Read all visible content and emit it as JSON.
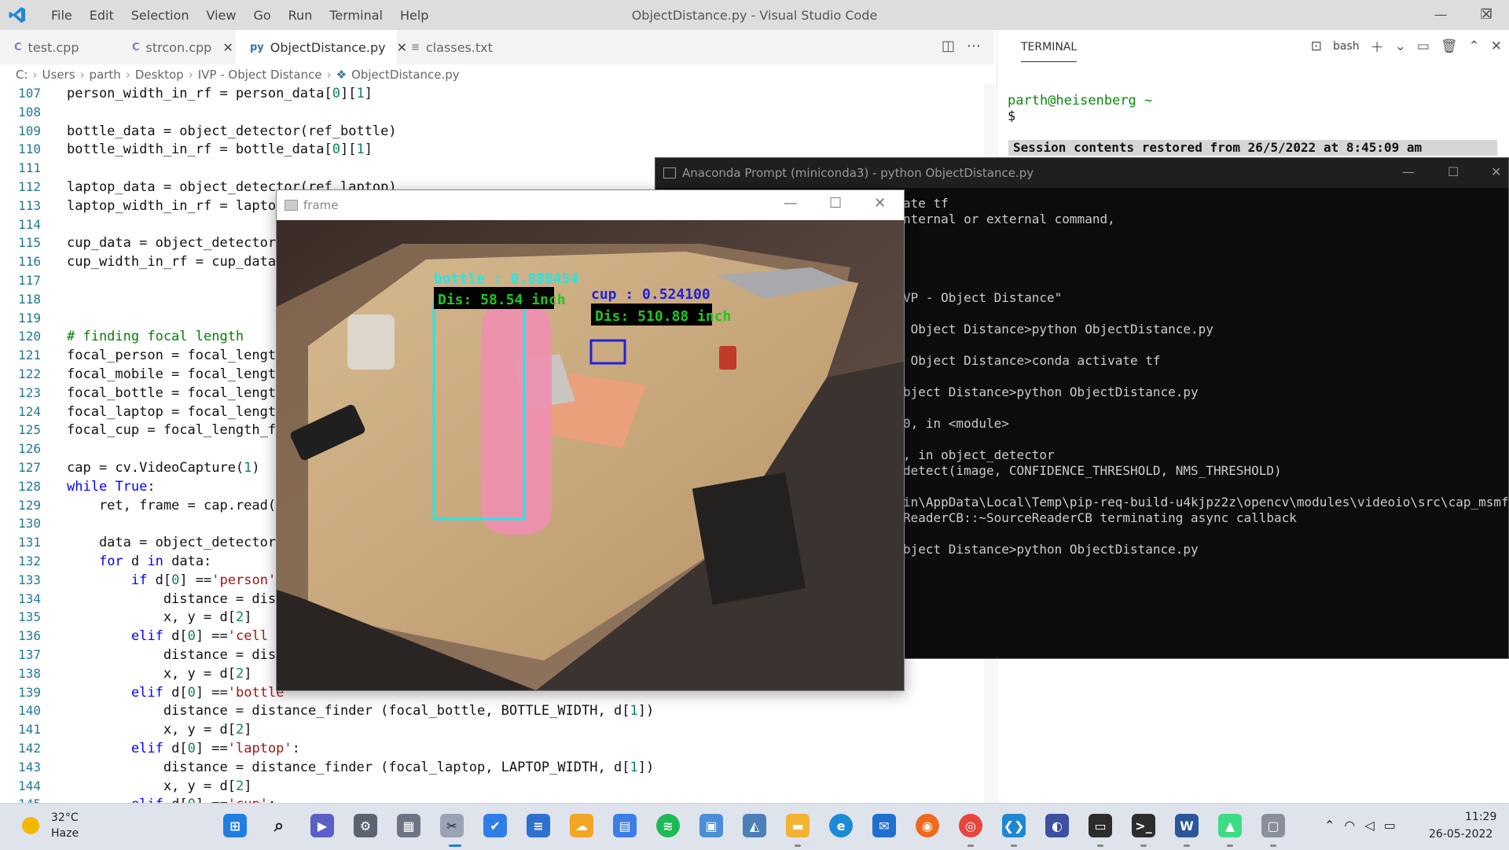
{
  "window": {
    "title": "ObjectDistance.py - Visual Studio Code"
  },
  "menu": [
    "File",
    "Edit",
    "Selection",
    "View",
    "Go",
    "Run",
    "Terminal",
    "Help"
  ],
  "tabs": [
    {
      "label": "test.cpp",
      "icon": "C"
    },
    {
      "label": "strcon.cpp",
      "icon": "C"
    },
    {
      "label": "ObjectDistance.py",
      "icon": "py"
    },
    {
      "label": "classes.txt",
      "icon": "≡"
    }
  ],
  "breadcrumb": [
    "C:",
    "Users",
    "parth",
    "Desktop",
    "IVP - Object Distance",
    "ObjectDistance.py"
  ],
  "code": {
    "line_numbers": [
      "107",
      "108",
      "109",
      "110",
      "111",
      "112",
      "113",
      "114",
      "115",
      "116",
      "117",
      "118",
      "119",
      "120",
      "121",
      "122",
      "123",
      "124",
      "125",
      "126",
      "127",
      "128",
      "129",
      "130",
      "131",
      "132",
      "133",
      "134",
      "135",
      "136",
      "137",
      "138",
      "139",
      "140",
      "141",
      "142",
      "143",
      "144",
      "145"
    ],
    "lines": [
      "person_width_in_rf = person_data[0][1]",
      "",
      "bottle_data = object_detector(ref_bottle)",
      "bottle_width_in_rf = bottle_data[0][1]",
      "",
      "laptop_data = object_detector(ref_laptop)",
      "laptop_width_in_rf = laptop_",
      "",
      "cup_data = object_detector(r",
      "cup_width_in_rf = cup_data[0",
      "",
      "",
      "",
      "# finding focal length",
      "focal_person = focal_length_",
      "focal_mobile = focal_length_",
      "focal_bottle = focal_length_",
      "focal_laptop = focal_length_",
      "focal_cup = focal_length_fir",
      "",
      "cap = cv.VideoCapture(1)",
      "while True:",
      "    ret, frame = cap.read()",
      "",
      "    data = object_detector(f",
      "    for d in data:",
      "        if d[0] =='person':",
      "            distance = dista",
      "            x, y = d[2]",
      "        elif d[0] =='cell ph",
      "            distance = dista",
      "            x, y = d[2]",
      "        elif d[0] =='bottle'",
      "            distance = distance_finder (focal_bottle, BOTTLE_WIDTH, d[1])",
      "            x, y = d[2]",
      "        elif d[0] =='laptop':",
      "            distance = distance_finder (focal_laptop, LAPTOP_WIDTH, d[1])",
      "            x, y = d[2]",
      "        elif d[0] =='cup':"
    ]
  },
  "terminal": {
    "tab_label": "TERMINAL",
    "shell_label": "bash",
    "prompt_user": "parth@heisenberg ~",
    "prompt_symbol": "$",
    "restored_message": "Session contents restored from 26/5/2022 at 8:45:09 am"
  },
  "anaconda": {
    "title": "Anaconda Prompt (miniconda3) - python  ObjectDistance.py",
    "lines": [
      {
        "text": "ate tf",
        "row": 0
      },
      {
        "text": "nternal or external command,",
        "row": 1
      },
      {
        "text": "VP - Object Distance\"",
        "row": 6
      },
      {
        "text": " Object Distance>python ObjectDistance.py",
        "row": 8
      },
      {
        "text": " Object Distance>conda activate tf",
        "row": 10
      },
      {
        "text": "bject Distance>python ObjectDistance.py",
        "row": 12
      },
      {
        "text": "0, in <module>",
        "row": 14
      },
      {
        "text": ", in object_detector",
        "row": 16
      },
      {
        "text": "detect(image, CONFIDENCE_THRESHOLD, NMS_THRESHOLD)",
        "row": 17
      },
      {
        "text": "in\\AppData\\Local\\Temp\\pip-req-build-u4kjpz2z\\opencv\\modules\\videoio\\src\\cap_msmf.cpp",
        "row": 19
      },
      {
        "text": "ReaderCB::~SourceReaderCB terminating async callback",
        "row": 20
      },
      {
        "text": "bject Distance>python ObjectDistance.py",
        "row": 22
      }
    ]
  },
  "frame": {
    "title": "frame",
    "detections": {
      "bottle_label": "bottle : 0.888454",
      "bottle_distance": "Dis: 58.54 inch",
      "cup_label": "cup : 0.524100",
      "cup_distance": "Dis: 510.88 inch"
    }
  },
  "taskbar": {
    "weather_temp": "32°C",
    "weather_desc": "Haze",
    "time": "11:29",
    "date": "26-05-2022"
  }
}
